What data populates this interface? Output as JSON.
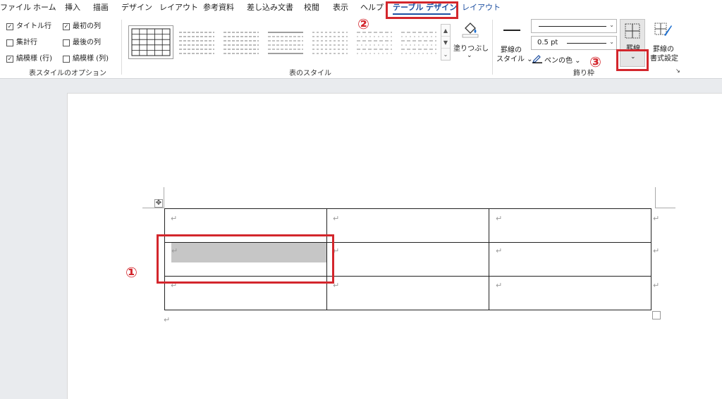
{
  "tabs": [
    "ファイル",
    "ホーム",
    "挿入",
    "描画",
    "デザイン",
    "レイアウト",
    "参考資料",
    "差し込み文書",
    "校閲",
    "表示",
    "ヘルプ",
    "テーブル デザイン",
    "レイアウト"
  ],
  "options_group": {
    "items": [
      {
        "label": "タイトル行",
        "checked": true
      },
      {
        "label": "最初の列",
        "checked": true
      },
      {
        "label": "集計行",
        "checked": false
      },
      {
        "label": "最後の列",
        "checked": false
      },
      {
        "label": "縞模様 (行)",
        "checked": true
      },
      {
        "label": "縞模様 (列)",
        "checked": false
      }
    ],
    "check_mark": "✓",
    "group_label": "表スタイルのオプション"
  },
  "styles_group": {
    "group_label": "表のスタイル",
    "scroll_up": "▲",
    "scroll_down": "▼",
    "scroll_more": "⌄"
  },
  "shading": {
    "label": "塗りつぶし",
    "chevron": "⌄"
  },
  "borders_group": {
    "border_style_label_1": "罫線の",
    "border_style_label_2": "スタイル ⌄",
    "pen_weight": "0.5 pt",
    "pen_color_label": "ペンの色 ⌄",
    "borders_label": "罫線",
    "borders_chevron": "⌄",
    "painter_label_1": "罫線の",
    "painter_label_2": "書式設定",
    "group_label": "飾り枠",
    "launcher": "↘",
    "combo_chevron": "⌄"
  },
  "annotations": {
    "n1": "①",
    "n2": "②",
    "n3": "③"
  },
  "document": {
    "move_handle": "✥",
    "return_mark": "↵",
    "rows": 3,
    "cols": 3
  },
  "colors": {
    "accent": "#1d4fa1",
    "highlight_red": "#d3262c",
    "cell_shade": "#c6c6c6"
  }
}
